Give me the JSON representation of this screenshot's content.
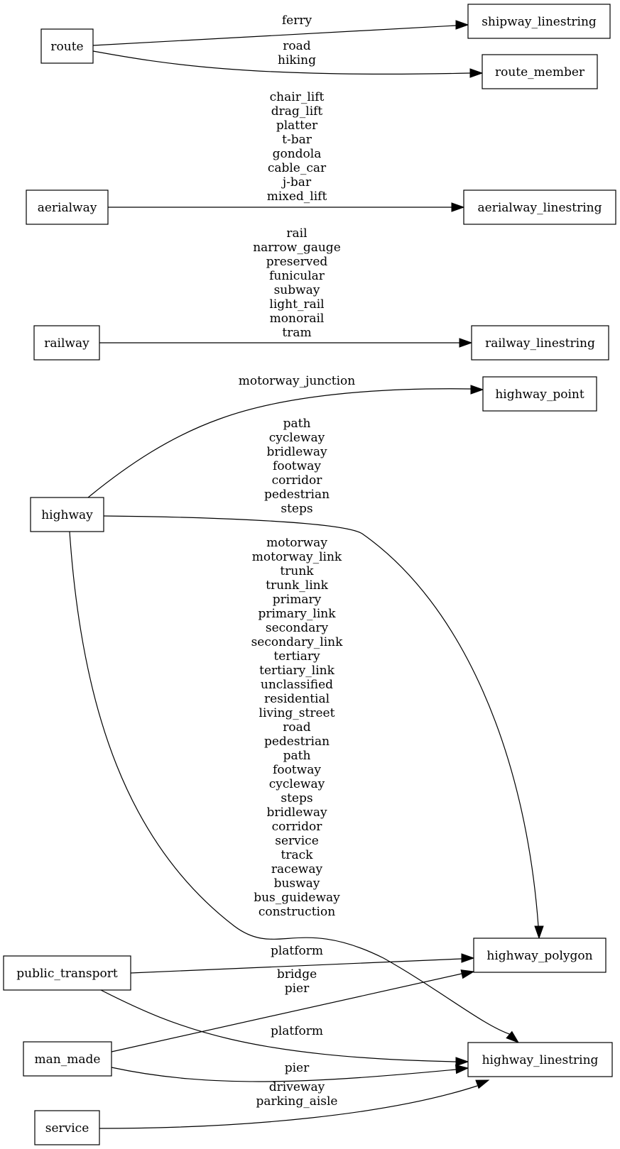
{
  "diagram": {
    "type": "directed-graph",
    "nodes": {
      "route": "route",
      "shipway_linestring": "shipway_linestring",
      "route_member": "route_member",
      "aerialway": "aerialway",
      "aerialway_linestring": "aerialway_linestring",
      "railway": "railway",
      "railway_linestring": "railway_linestring",
      "highway": "highway",
      "highway_point": "highway_point",
      "highway_polygon": "highway_polygon",
      "highway_linestring": "highway_linestring",
      "public_transport": "public_transport",
      "man_made": "man_made",
      "service": "service"
    },
    "edges": [
      {
        "from": "route",
        "to": "shipway_linestring",
        "labels": [
          "ferry"
        ]
      },
      {
        "from": "route",
        "to": "route_member",
        "labels": [
          "road",
          "hiking"
        ]
      },
      {
        "from": "aerialway",
        "to": "aerialway_linestring",
        "labels": [
          "chair_lift",
          "drag_lift",
          "platter",
          "t-bar",
          "gondola",
          "cable_car",
          "j-bar",
          "mixed_lift"
        ]
      },
      {
        "from": "railway",
        "to": "railway_linestring",
        "labels": [
          "rail",
          "narrow_gauge",
          "preserved",
          "funicular",
          "subway",
          "light_rail",
          "monorail",
          "tram"
        ]
      },
      {
        "from": "highway",
        "to": "highway_point",
        "labels": [
          "motorway_junction"
        ]
      },
      {
        "from": "highway",
        "to": "highway_polygon",
        "labels": [
          "path",
          "cycleway",
          "bridleway",
          "footway",
          "corridor",
          "pedestrian",
          "steps"
        ]
      },
      {
        "from": "highway",
        "to": "highway_linestring",
        "labels": [
          "motorway",
          "motorway_link",
          "trunk",
          "trunk_link",
          "primary",
          "primary_link",
          "secondary",
          "secondary_link",
          "tertiary",
          "tertiary_link",
          "unclassified",
          "residential",
          "living_street",
          "road",
          "pedestrian",
          "path",
          "footway",
          "cycleway",
          "steps",
          "bridleway",
          "corridor",
          "service",
          "track",
          "raceway",
          "busway",
          "bus_guideway",
          "construction"
        ]
      },
      {
        "from": "public_transport",
        "to": "highway_polygon",
        "labels": [
          "platform"
        ]
      },
      {
        "from": "man_made",
        "to": "highway_polygon",
        "labels": [
          "bridge",
          "pier"
        ]
      },
      {
        "from": "public_transport",
        "to": "highway_linestring",
        "labels": [
          "platform"
        ]
      },
      {
        "from": "man_made",
        "to": "highway_linestring",
        "labels": [
          "pier"
        ]
      },
      {
        "from": "service",
        "to": "highway_linestring",
        "labels": [
          "driveway",
          "parking_aisle"
        ]
      }
    ]
  }
}
